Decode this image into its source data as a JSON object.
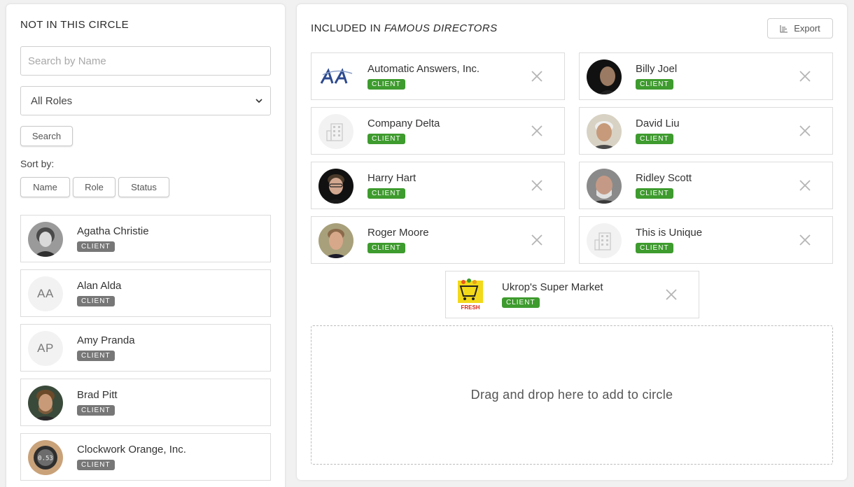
{
  "left": {
    "title": "NOT IN THIS CIRCLE",
    "search_placeholder": "Search by Name",
    "role_select": "All Roles",
    "search_button": "Search",
    "sort_label": "Sort by:",
    "sort_buttons": [
      "Name",
      "Role",
      "Status"
    ],
    "people": [
      {
        "name": "Agatha Christie",
        "badge": "CLIENT"
      },
      {
        "name": "Alan Alda",
        "badge": "CLIENT",
        "initials": "AA"
      },
      {
        "name": "Amy Pranda",
        "badge": "CLIENT",
        "initials": "AP"
      },
      {
        "name": "Brad Pitt",
        "badge": "CLIENT"
      },
      {
        "name": "Clockwork Orange, Inc.",
        "badge": "CLIENT",
        "logo_text": "0.53"
      }
    ]
  },
  "right": {
    "title_prefix": "INCLUDED IN ",
    "title_circle": "FAMOUS DIRECTORS",
    "export_button": "Export",
    "members": [
      {
        "name": "Automatic Answers, Inc.",
        "badge": "CLIENT"
      },
      {
        "name": "Billy Joel",
        "badge": "CLIENT"
      },
      {
        "name": "Company Delta",
        "badge": "CLIENT"
      },
      {
        "name": "David Liu",
        "badge": "CLIENT"
      },
      {
        "name": "Harry Hart",
        "badge": "CLIENT"
      },
      {
        "name": "Ridley Scott",
        "badge": "CLIENT"
      },
      {
        "name": "Roger Moore",
        "badge": "CLIENT"
      },
      {
        "name": "This is Unique",
        "badge": "CLIENT"
      },
      {
        "name": "Ukrop's Super Market",
        "badge": "CLIENT",
        "logo_text": "FRESH"
      }
    ],
    "drop_zone": "Drag and drop here to add to circle"
  },
  "colors": {
    "client_badge_included": "#3e9b2e",
    "client_badge_excluded": "#777777",
    "background": "#f1f1f1"
  }
}
